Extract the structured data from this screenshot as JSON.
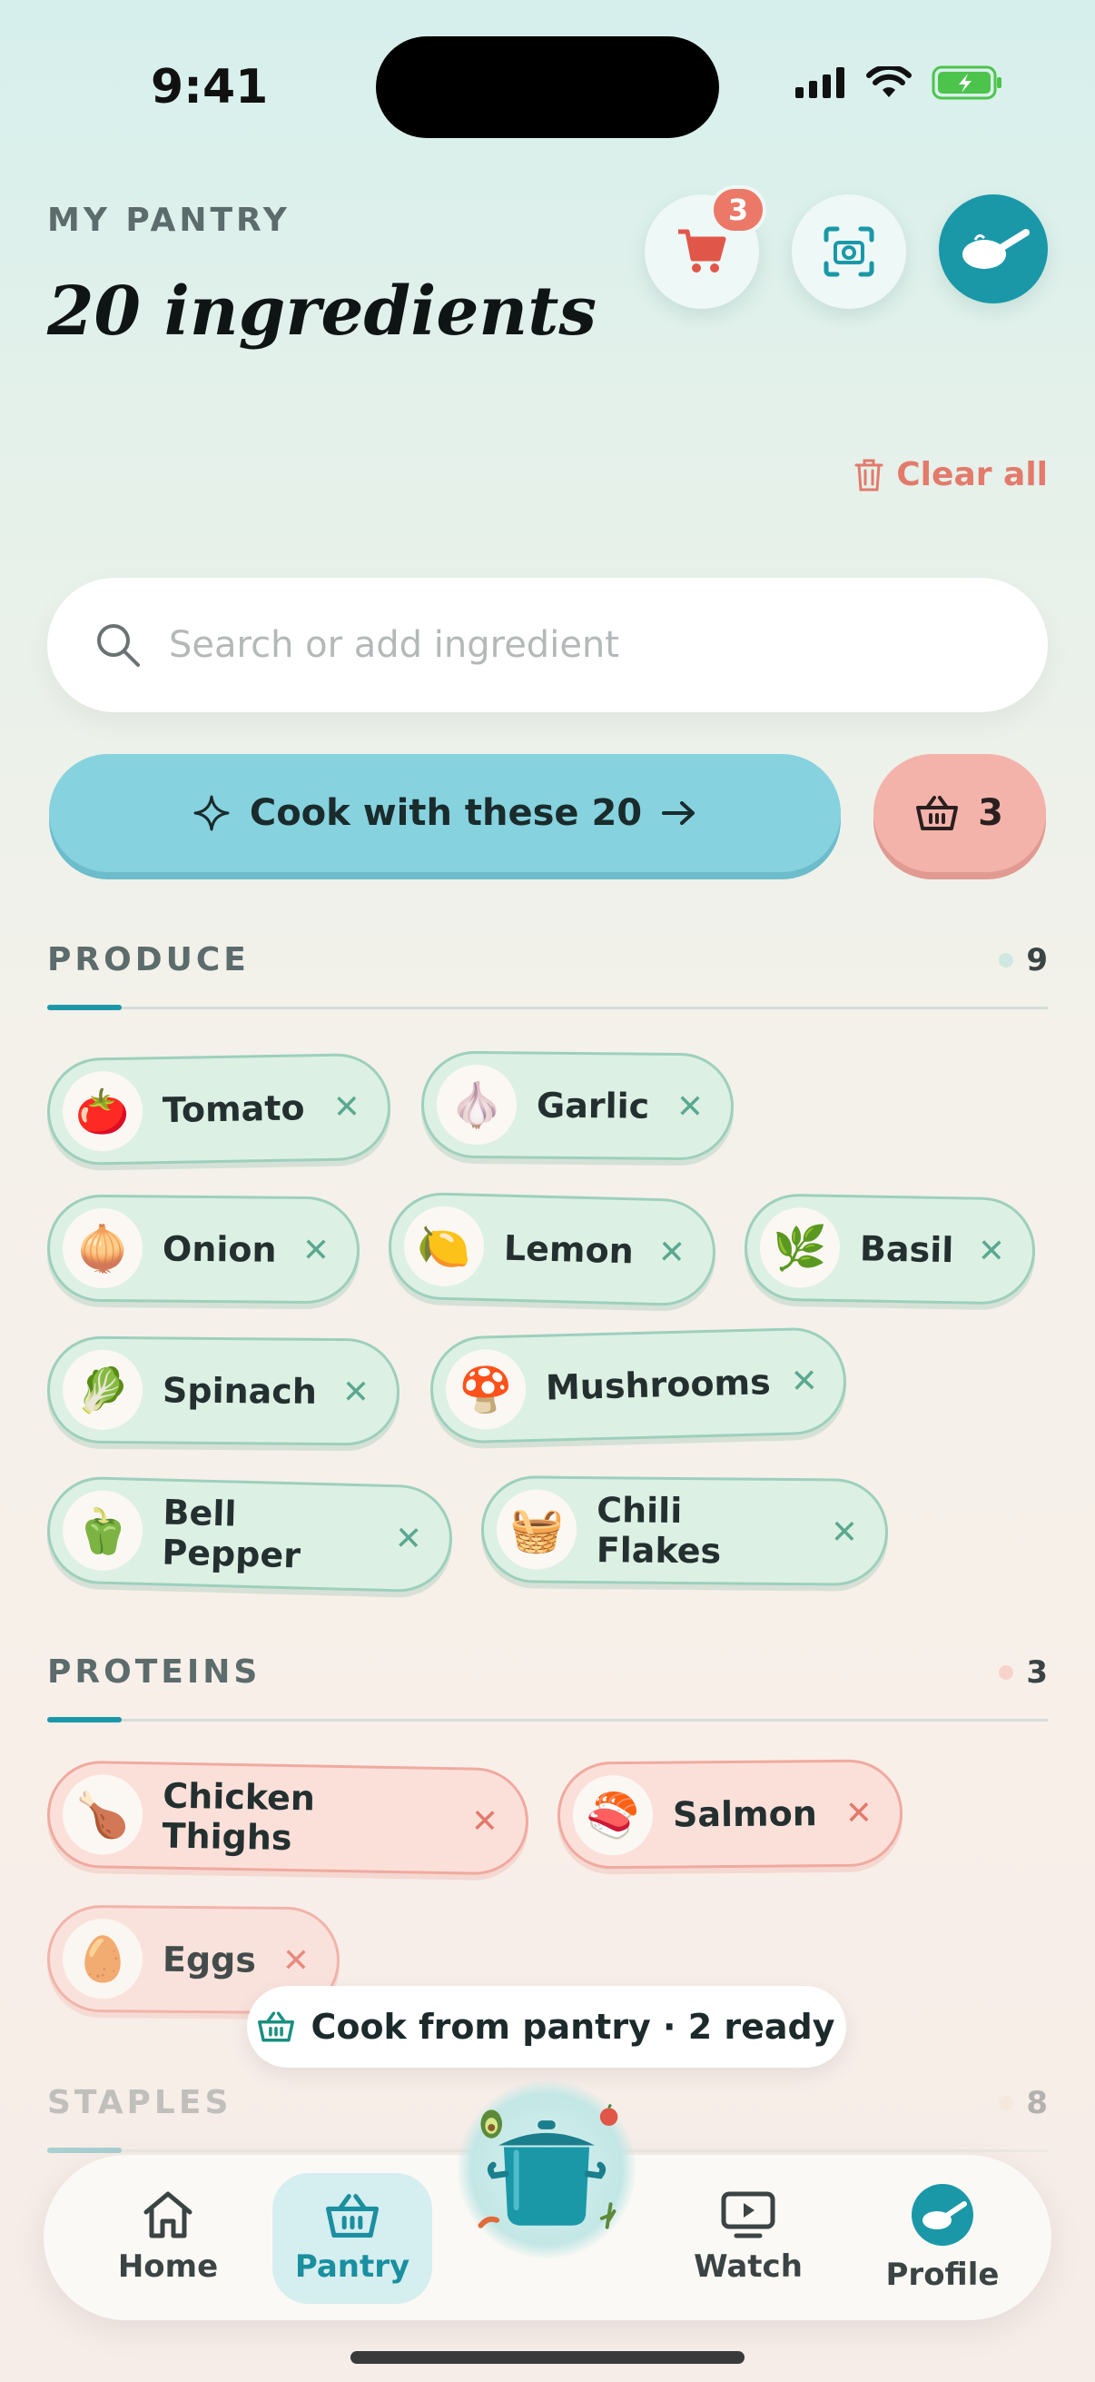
{
  "status": {
    "time": "9:41"
  },
  "header": {
    "eyebrow": "MY PANTRY",
    "title": "20 ingredients",
    "cart_badge": "3",
    "clear_all": "Clear all"
  },
  "search": {
    "placeholder": "Search or add ingredient"
  },
  "actions": {
    "cook_label": "Cook with these 20",
    "basket_count": "3"
  },
  "sections": {
    "produce": {
      "title": "PRODUCE",
      "count": "9"
    },
    "proteins": {
      "title": "PROTEINS",
      "count": "3"
    },
    "staples": {
      "title": "STAPLES",
      "count": "8"
    }
  },
  "produce": [
    {
      "label": "Tomato",
      "icon": "tomato-icon",
      "glyph": "🍅"
    },
    {
      "label": "Garlic",
      "icon": "garlic-icon",
      "glyph": "🧄"
    },
    {
      "label": "Onion",
      "icon": "onion-icon",
      "glyph": "🧅"
    },
    {
      "label": "Lemon",
      "icon": "lemon-icon",
      "glyph": "🍋"
    },
    {
      "label": "Basil",
      "icon": "basil-icon",
      "glyph": "🌿"
    },
    {
      "label": "Spinach",
      "icon": "spinach-icon",
      "glyph": "🥬"
    },
    {
      "label": "Mushrooms",
      "icon": "mushroom-icon",
      "glyph": "🍄"
    },
    {
      "label": "Bell Pepper",
      "icon": "bell-pepper-icon",
      "glyph": "🫑"
    },
    {
      "label": "Chili Flakes",
      "icon": "basket-icon",
      "glyph": "🧺"
    }
  ],
  "proteins": [
    {
      "label": "Chicken Thighs",
      "icon": "chicken-leg-icon",
      "glyph": "🍗"
    },
    {
      "label": "Salmon",
      "icon": "salmon-icon",
      "glyph": "🍣"
    },
    {
      "label": "Eggs",
      "icon": "egg-icon",
      "glyph": "🥚"
    }
  ],
  "toast": {
    "text": "Cook from pantry · 2 ready"
  },
  "nav": {
    "home": "Home",
    "pantry": "Pantry",
    "watch": "Watch",
    "profile": "Profile"
  },
  "colors": {
    "accent": "#1a98a8",
    "produce_chip": "#ddf0e4",
    "protein_chip": "#fbe0da",
    "cook_button": "#86d2de",
    "alert": "#ec7868"
  }
}
